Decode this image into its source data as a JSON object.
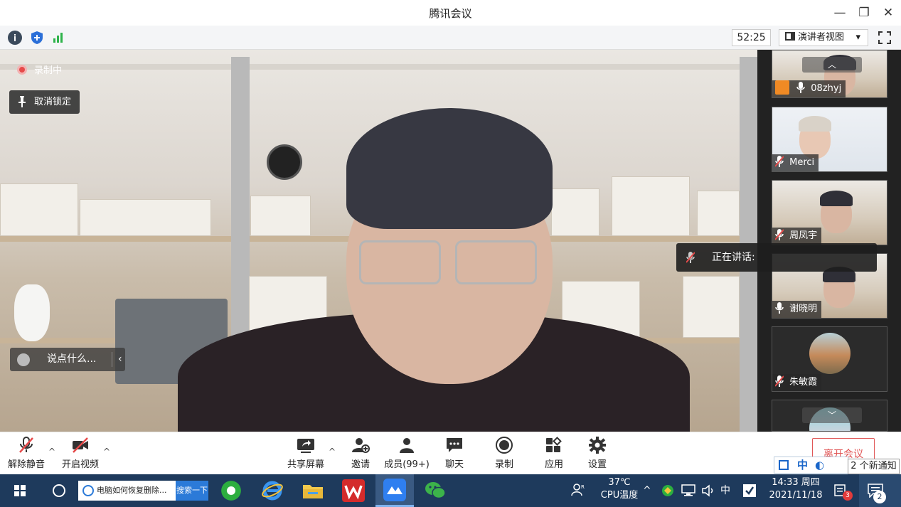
{
  "window": {
    "title": "腾讯会议",
    "minimize": "—",
    "restore": "❐",
    "close": "✕"
  },
  "toolbar": {
    "timer": "52:25",
    "view_mode": "演讲者视图",
    "view_caret": "▾"
  },
  "main": {
    "recording_label": "录制中",
    "unpin_label": "取消锁定",
    "chat_placeholder": "说点什么...",
    "chat_arrow": "‹"
  },
  "participants": [
    {
      "name": "08zhyj",
      "role": "host"
    },
    {
      "name": "Merci"
    },
    {
      "name": "周凤宇"
    },
    {
      "name": "谢晓明"
    },
    {
      "name": "朱敏霞"
    }
  ],
  "speaking": {
    "label": "正在讲话:"
  },
  "controls": {
    "unmute": "解除静音",
    "start_video": "开启视频",
    "share_screen": "共享屏幕",
    "invite": "邀请",
    "members": "成员(99+)",
    "chat": "聊天",
    "record": "录制",
    "apps": "应用",
    "settings": "设置",
    "leave": "离开会议",
    "caret": "^"
  },
  "ime": {
    "mode": "中",
    "notification": "2 个新通知"
  },
  "taskbar": {
    "search_text": "电脑如何恢复删除...",
    "search_button": "搜索一下",
    "cpu_temp": "37℃",
    "cpu_label": "CPU温度",
    "tray_ime": "中",
    "time": "14:33 周四",
    "date": "2021/11/18",
    "mail_badge": "3",
    "notification_badge": "2"
  },
  "colors": {
    "accent_blue": "#1a66c9",
    "leave_red": "#e05656",
    "host_orange": "#f08a24",
    "taskbar": "#1e3a5c"
  }
}
